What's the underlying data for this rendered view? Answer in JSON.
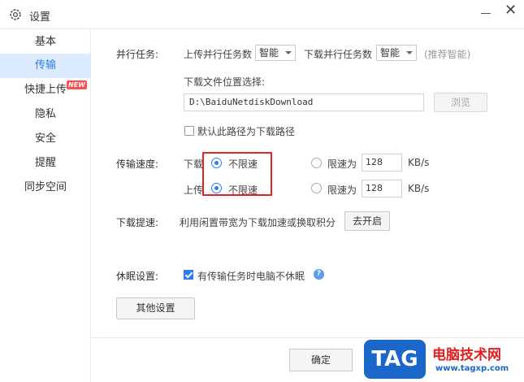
{
  "window": {
    "title": "设置",
    "icon": "gear-icon",
    "close_glyph": "✕"
  },
  "sidebar": {
    "items": [
      {
        "label": "基本",
        "active": false
      },
      {
        "label": "传输",
        "active": true
      },
      {
        "label": "快捷上传",
        "active": false,
        "badge": "NEW"
      },
      {
        "label": "隐私",
        "active": false
      },
      {
        "label": "安全",
        "active": false
      },
      {
        "label": "提醒",
        "active": false
      },
      {
        "label": "同步空间",
        "active": false
      }
    ]
  },
  "parallel": {
    "label": "并行任务:",
    "upload_label": "上传并行任务数",
    "upload_value": "智能",
    "download_label": "下载并行任务数",
    "download_value": "智能",
    "hint": "(推荐智能)"
  },
  "download_location": {
    "label": "下载文件位置选择:",
    "path": "D:\\BaiduNetdiskDownload",
    "browse_label": "浏览",
    "default_checkbox_label": "默认此路径为下载路径",
    "default_checked": false
  },
  "speed": {
    "label": "传输速度:",
    "download_label": "下载",
    "upload_label": "上传",
    "unlimited_label": "不限速",
    "limit_label": "限速为",
    "download_limit": "128",
    "upload_limit": "128",
    "unit": "KB/s",
    "download_mode": "unlimited",
    "upload_mode": "unlimited"
  },
  "boost": {
    "label": "下载提速:",
    "description": "利用闲置带宽为下载加速或换取积分",
    "button_label": "去开启"
  },
  "sleep": {
    "label": "休眠设置:",
    "checkbox_label": "有传输任务时电脑不休眠",
    "checked": true
  },
  "other_settings_label": "其他设置",
  "footer": {
    "ok_label": "确定"
  },
  "watermark": {
    "logo_text": "TAG",
    "site_name": "电脑技术网",
    "url": "www.tagxp.com"
  },
  "colors": {
    "accent": "#2b7cf0",
    "active_bg": "#dcebff",
    "highlight": "#e52222",
    "badge": "#ff4d4d"
  }
}
